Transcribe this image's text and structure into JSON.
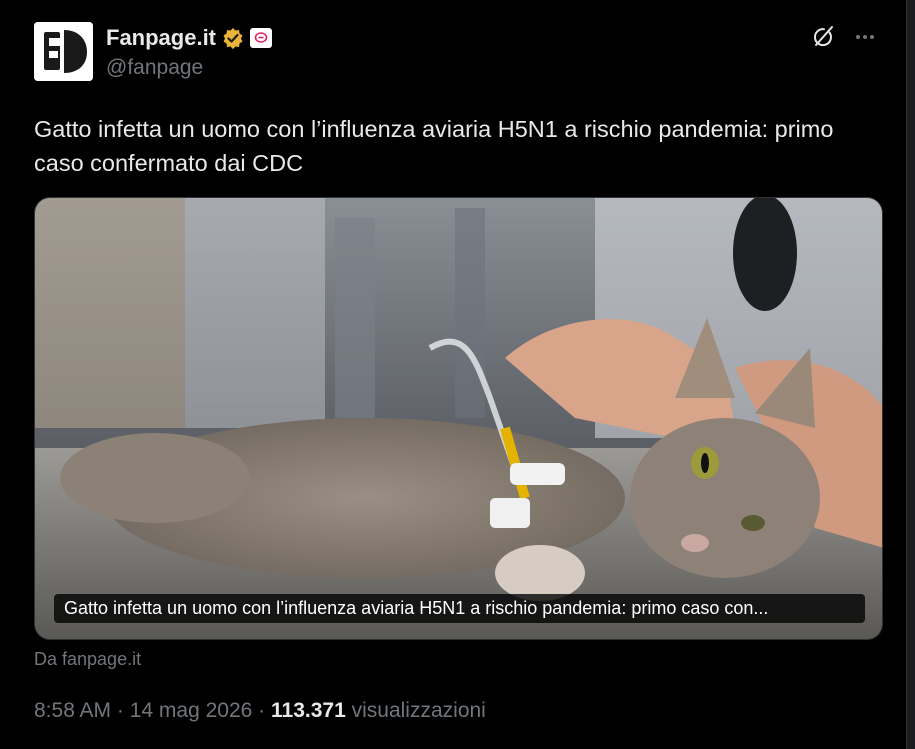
{
  "author": {
    "name": "Fanpage.it",
    "handle": "@fanpage",
    "verified_icon": "verified-gold-badge",
    "affiliate_icon": "affiliate-badge"
  },
  "header_actions": {
    "grok_icon": "grok-icon",
    "more_icon": "more-icon"
  },
  "tweet": {
    "text": "Gatto infetta un uomo con l’influenza aviaria H5N1 a rischio pandemia: primo caso confermato dai CDC",
    "card_caption": "Gatto infetta un uomo con l’influenza aviaria H5N1 a rischio pandemia: primo caso con...",
    "source": "Da fanpage.it"
  },
  "meta": {
    "time": "8:58 AM",
    "sep1": " · ",
    "date": "14 mag 2026",
    "sep2": " · ",
    "views_count": "113.371",
    "views_label": " visualizzazioni"
  },
  "colors": {
    "background": "#000000",
    "text_primary": "#e7e9ea",
    "text_secondary": "#71767b",
    "verified_gold": "#e8b339"
  }
}
